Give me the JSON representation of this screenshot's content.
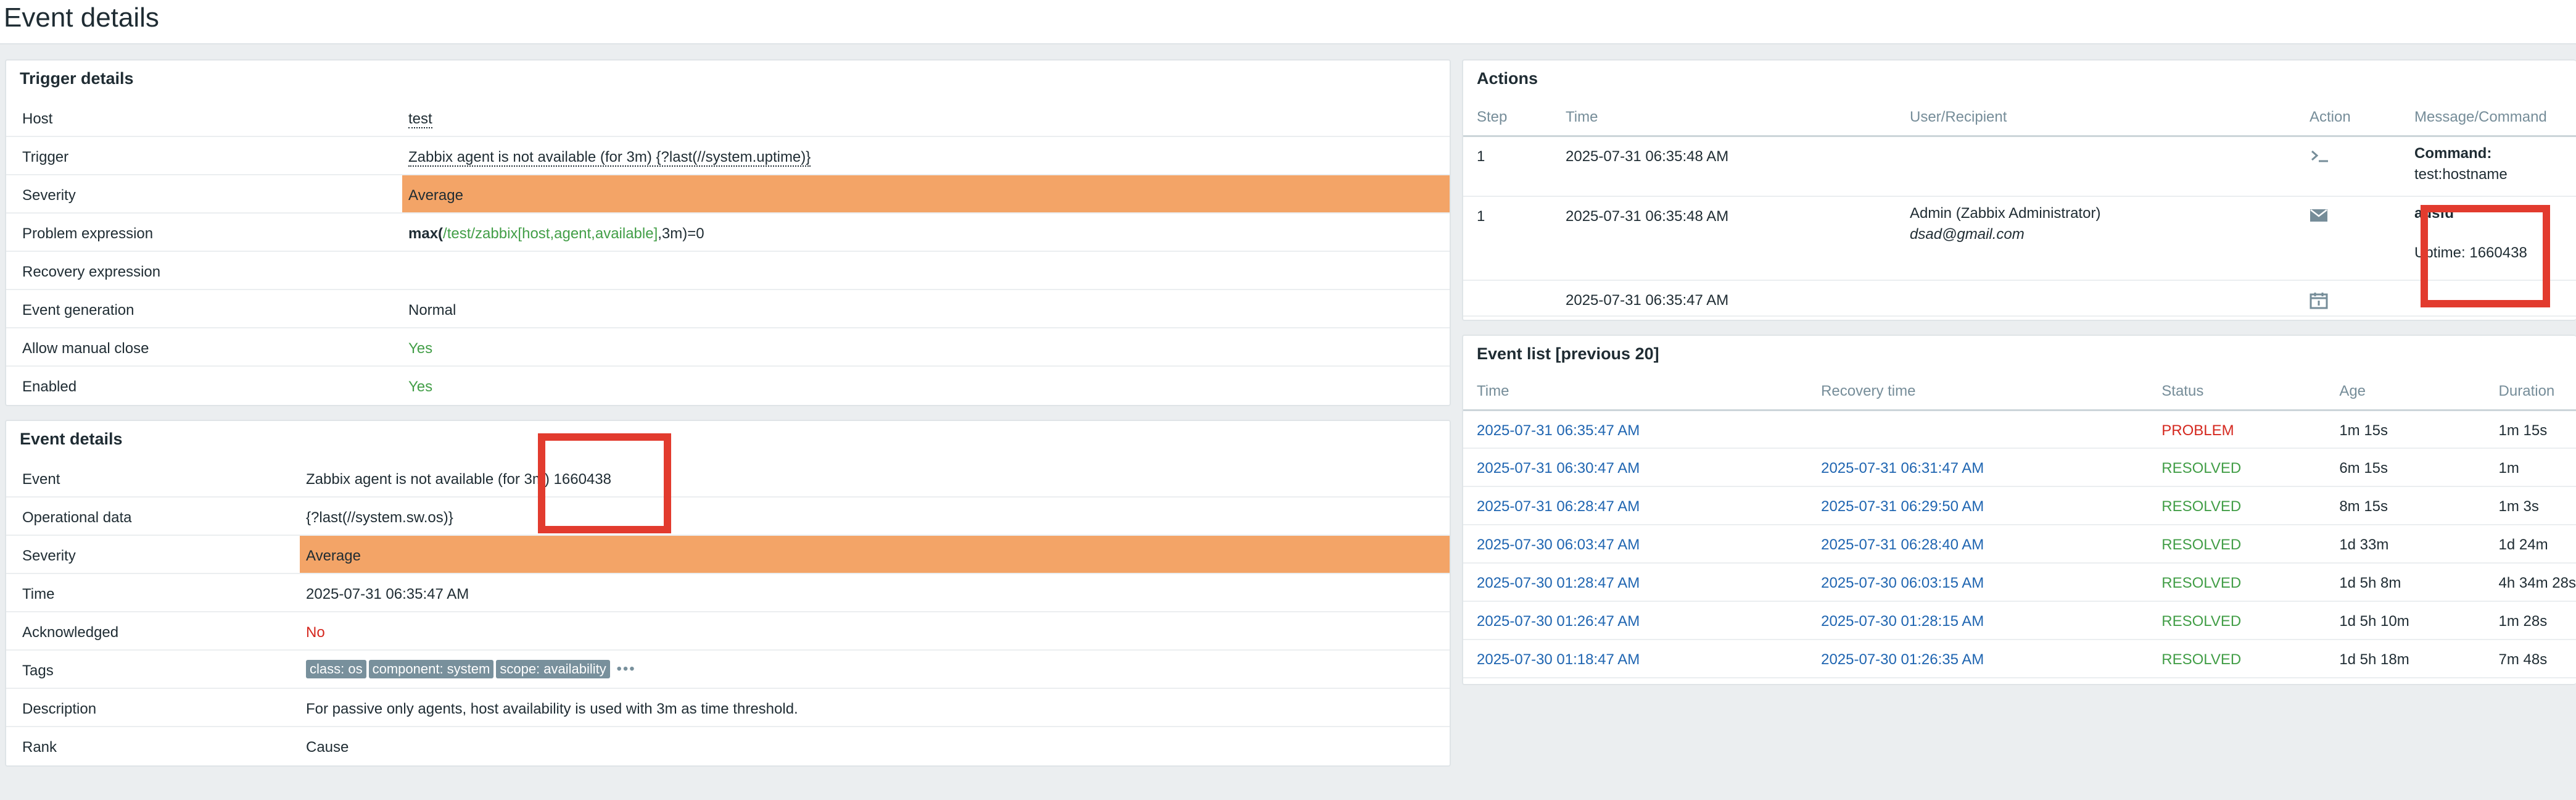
{
  "page": {
    "title": "Event details"
  },
  "colors": {
    "severity_average": "#f3a467",
    "ok_green": "#429e47",
    "problem_red": "#d5281f",
    "link_blue": "#1f65b1",
    "redact_box": "#e23b2e"
  },
  "trigger_details": {
    "title": "Trigger details",
    "rows": [
      {
        "label": "Host",
        "value": "test"
      },
      {
        "label": "Trigger",
        "value": "Zabbix agent is not available (for 3m) {?last(//system.uptime)}"
      },
      {
        "label": "Severity",
        "value": "Average"
      },
      {
        "label": "Problem expression",
        "value_prefix": "max(",
        "value_link": "/test/zabbix[host,agent,available]",
        "value_suffix": ",3m)=0"
      },
      {
        "label": "Recovery expression",
        "value": ""
      },
      {
        "label": "Event generation",
        "value": "Normal"
      },
      {
        "label": "Allow manual close",
        "value": "Yes"
      },
      {
        "label": "Enabled",
        "value": "Yes"
      }
    ]
  },
  "event_details": {
    "title": "Event details",
    "rows": [
      {
        "label": "Event",
        "value": "Zabbix agent is not available (for 3m) 1660438"
      },
      {
        "label": "Operational data",
        "value": "{?last(//system.sw.os)}"
      },
      {
        "label": "Severity",
        "value": "Average"
      },
      {
        "label": "Time",
        "value": "2025-07-31 06:35:47 AM"
      },
      {
        "label": "Acknowledged",
        "value": "No"
      },
      {
        "label": "Tags",
        "tags": [
          "class: os",
          "component: system",
          "scope: availability"
        ],
        "more": "•••"
      },
      {
        "label": "Description",
        "value": "For passive only agents, host availability is used with 3m as time threshold."
      },
      {
        "label": "Rank",
        "value": "Cause"
      }
    ]
  },
  "actions": {
    "title": "Actions",
    "columns": [
      "Step",
      "Time",
      "User/Recipient",
      "Action",
      "Message/Command"
    ],
    "rows": [
      {
        "step": "1",
        "time": "2025-07-31 06:35:48 AM",
        "user": "",
        "email": "",
        "action_icon": "terminal-icon",
        "msg_title": "Command:",
        "msg_body": "test:hostname"
      },
      {
        "step": "1",
        "time": "2025-07-31 06:35:48 AM",
        "user": "Admin (Zabbix Administrator)",
        "email": "dsad@gmail.com",
        "action_icon": "envelope-icon",
        "msg_title": "adsfd",
        "msg_body": "Uptime: 1660438"
      },
      {
        "step": "",
        "time": "2025-07-31 06:35:47 AM",
        "user": "",
        "email": "",
        "action_icon": "calendar-icon",
        "msg_title": "",
        "msg_body": ""
      }
    ]
  },
  "event_list": {
    "title": "Event list [previous 20]",
    "columns": [
      "Time",
      "Recovery time",
      "Status",
      "Age",
      "Duration"
    ],
    "rows": [
      {
        "time": "2025-07-31 06:35:47 AM",
        "recovery": "",
        "status": "PROBLEM",
        "age": "1m 15s",
        "duration": "1m 15s"
      },
      {
        "time": "2025-07-31 06:30:47 AM",
        "recovery": "2025-07-31 06:31:47 AM",
        "status": "RESOLVED",
        "age": "6m 15s",
        "duration": "1m"
      },
      {
        "time": "2025-07-31 06:28:47 AM",
        "recovery": "2025-07-31 06:29:50 AM",
        "status": "RESOLVED",
        "age": "8m 15s",
        "duration": "1m 3s"
      },
      {
        "time": "2025-07-30 06:03:47 AM",
        "recovery": "2025-07-31 06:28:40 AM",
        "status": "RESOLVED",
        "age": "1d 33m",
        "duration": "1d 24m"
      },
      {
        "time": "2025-07-30 01:28:47 AM",
        "recovery": "2025-07-30 06:03:15 AM",
        "status": "RESOLVED",
        "age": "1d 5h 8m",
        "duration": "4h 34m 28s"
      },
      {
        "time": "2025-07-30 01:26:47 AM",
        "recovery": "2025-07-30 01:28:15 AM",
        "status": "RESOLVED",
        "age": "1d 5h 10m",
        "duration": "1m 28s"
      },
      {
        "time": "2025-07-30 01:18:47 AM",
        "recovery": "2025-07-30 01:26:35 AM",
        "status": "RESOLVED",
        "age": "1d 5h 18m",
        "duration": "7m 48s"
      }
    ]
  }
}
